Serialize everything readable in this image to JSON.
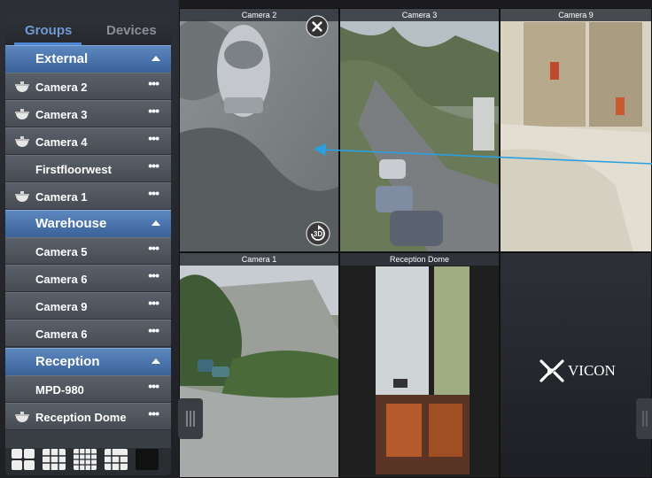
{
  "sidebar": {
    "tabs": {
      "groups": "Groups",
      "devices": "Devices"
    },
    "groups": [
      {
        "label": "External"
      },
      {
        "label": "Warehouse"
      },
      {
        "label": "Reception"
      }
    ],
    "rows": [
      {
        "label": "Camera 2",
        "icon": "dome-camera-icon",
        "has_icon": true
      },
      {
        "label": "Camera 3",
        "icon": "dome-camera-icon",
        "has_icon": true
      },
      {
        "label": "Camera 4",
        "icon": "dome-camera-icon",
        "has_icon": true
      },
      {
        "label": "Firstfloorwest",
        "has_icon": false
      },
      {
        "label": "Camera 1",
        "icon": "dome-camera-icon",
        "has_icon": true
      },
      {
        "label": "Camera 5",
        "has_icon": false
      },
      {
        "label": "Camera 6",
        "has_icon": false
      },
      {
        "label": "Camera 9",
        "has_icon": false
      },
      {
        "label": "Camera 6",
        "has_icon": false
      },
      {
        "label": "MPD-980",
        "has_icon": false
      },
      {
        "label": "Reception Dome",
        "icon": "dome-camera-icon",
        "has_icon": true
      }
    ],
    "more_glyph": "•••",
    "layout_buttons": [
      "layout-2x2-icon",
      "layout-3x3-icon",
      "layout-4x4-icon",
      "layout-mixed-icon",
      "layout-single-icon"
    ]
  },
  "grid": {
    "tiles": [
      {
        "label": "Camera 2"
      },
      {
        "label": "Camera 3"
      },
      {
        "label": "Camera 9"
      },
      {
        "label": "Camera 1"
      },
      {
        "label": "Reception Dome"
      }
    ],
    "logo": {
      "text": "VICON"
    },
    "accent": "#2aa0e0"
  }
}
